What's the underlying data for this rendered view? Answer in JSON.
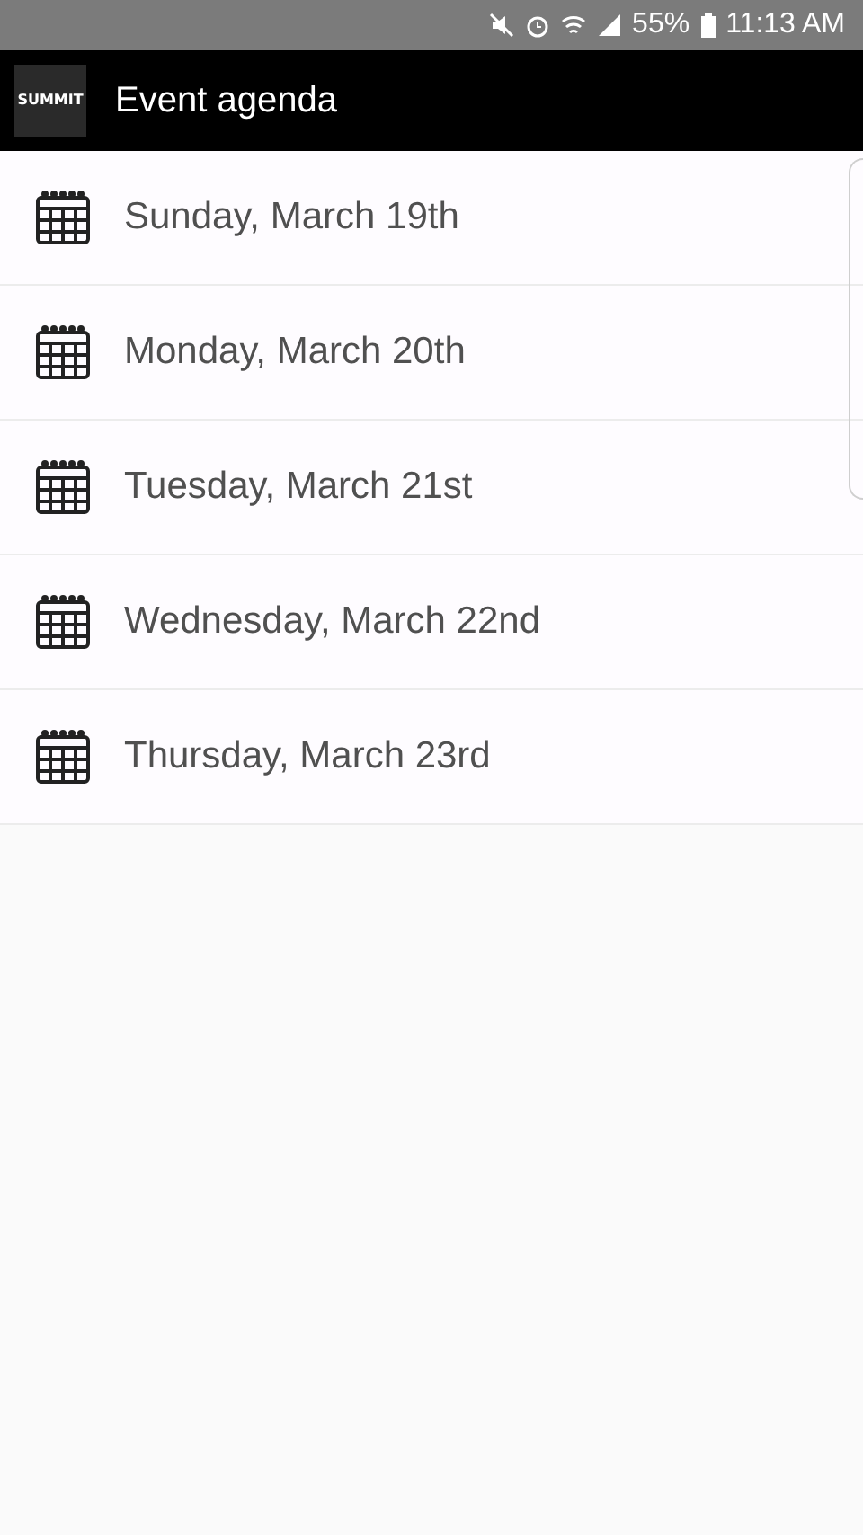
{
  "status_bar": {
    "battery_percent": "55%",
    "time": "11:13 AM"
  },
  "app_bar": {
    "logo": "SUMMIT",
    "title": "Event agenda"
  },
  "days": [
    {
      "label": "Sunday, March 19th"
    },
    {
      "label": "Monday, March 20th"
    },
    {
      "label": "Tuesday, March 21st"
    },
    {
      "label": "Wednesday, March 22nd"
    },
    {
      "label": "Thursday, March 23rd"
    }
  ]
}
